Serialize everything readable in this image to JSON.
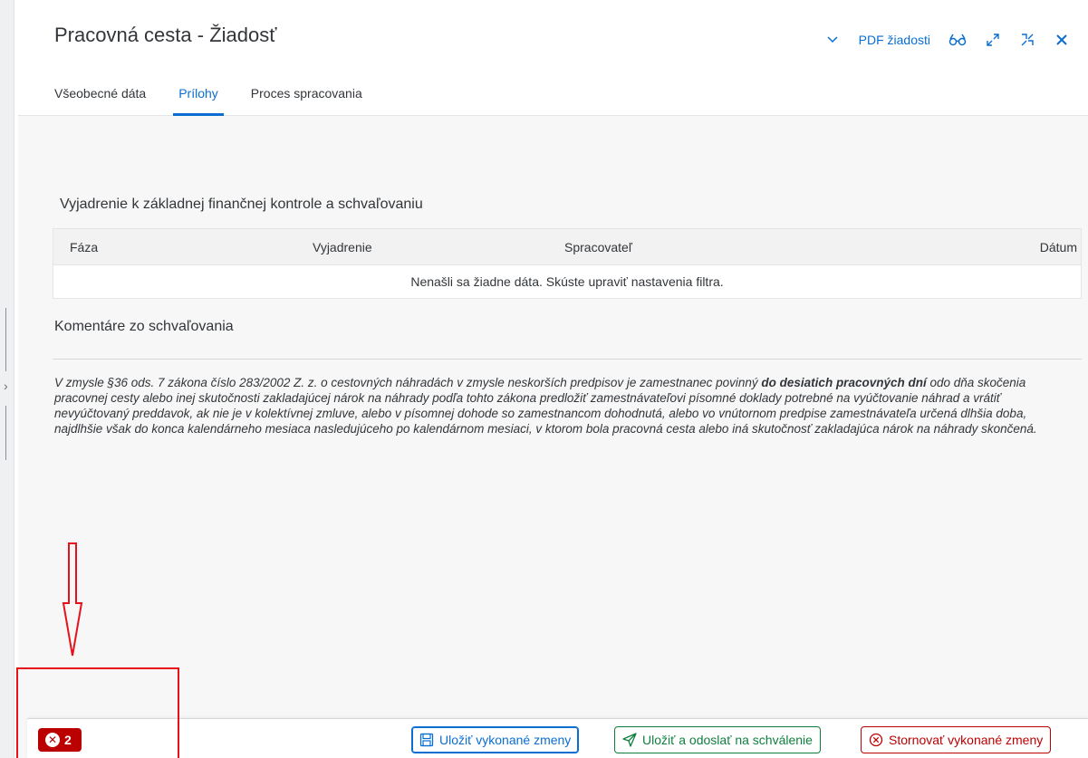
{
  "header": {
    "title": "Pracovná cesta - Žiadosť",
    "pdf_label": "PDF žiadosti"
  },
  "tabs": [
    {
      "label": "Všeobecné dáta",
      "active": false
    },
    {
      "label": "Prílohy",
      "active": true
    },
    {
      "label": "Proces spracovania",
      "active": false
    }
  ],
  "control_section": {
    "title": "Vyjadrenie k základnej finančnej kontrole a schvaľovaniu",
    "columns": [
      "Fáza",
      "Vyjadrenie",
      "Spracovateľ",
      "Dátum"
    ],
    "empty_text": "Nenašli sa žiadne dáta. Skúste upraviť nastavenia filtra."
  },
  "comments_section": {
    "title": "Komentáre zo schvaľovania"
  },
  "legal": {
    "part1": "V zmysle §36 ods. 7 zákona číslo 283/2002 Z. z. o cestovných náhradách v zmysle neskorších predpisov je zamestnanec povinný ",
    "bold": "do desiatich pracovných dní",
    "part2": " odo dňa skočenia pracovnej cesty alebo inej skutočnosti zakladajúcej nárok na náhrady podľa tohto zákona predložiť zamestnávateľovi písomné doklady potrebné na vyúčtovanie náhrad a vrátiť nevyúčtovaný preddavok, ak nie je v kolektívnej zmluve, alebo v písomnej dohode so zamestnancom dohodnutá, alebo vo vnútornom predpise zamestnávateľa určená dlhšia doba, najdlhšie však do konca kalendárneho mesiaca nasledujúceho po kalendárnom mesiaci, v ktorom bola pracovná cesta alebo iná skutočnosť zakladajúca nárok na náhrady skončená."
  },
  "footer": {
    "error_count": "2",
    "save_label": "Uložiť vykonané zmeny",
    "send_label": "Uložiť a odoslať na schválenie",
    "cancel_label": "Stornovať vykonané zmeny"
  },
  "colors": {
    "accent": "#0a6ed1",
    "positive": "#107e3e",
    "negative": "#bb0000",
    "annotation": "#e8101a"
  },
  "icons": [
    "chevron-down-icon",
    "glasses-icon",
    "expand-icon",
    "collapse-icon",
    "close-icon",
    "save-icon",
    "send-icon",
    "cancel-circle-icon",
    "error-icon"
  ]
}
